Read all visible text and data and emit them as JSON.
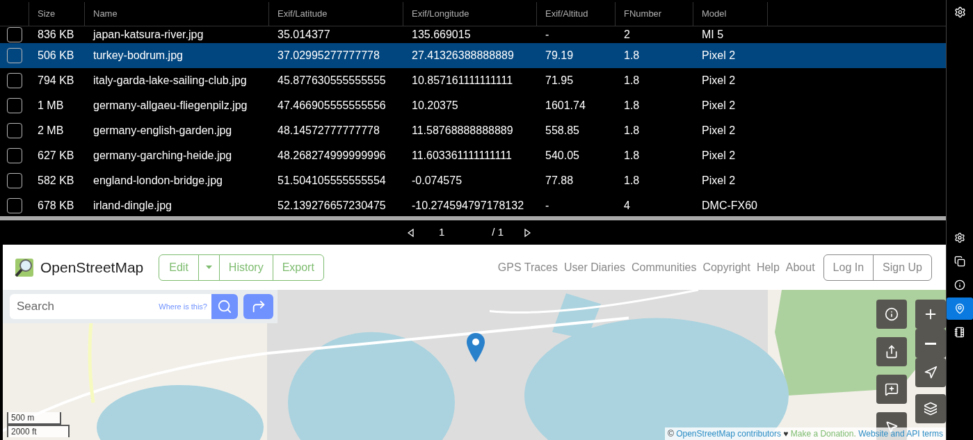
{
  "table": {
    "columns": [
      "Size",
      "Name",
      "Exif/Latitude",
      "Exif/Longitude",
      "Exif/Altitud",
      "FNumber",
      "Model"
    ],
    "rows": [
      {
        "checked": false,
        "selected": false,
        "cells": [
          "836 KB",
          "japan-katsura-river.jpg",
          "35.014377",
          "135.669015",
          "-",
          "2",
          "MI 5"
        ]
      },
      {
        "checked": false,
        "selected": true,
        "cells": [
          "506 KB",
          "turkey-bodrum.jpg",
          "37.02995277777778",
          "27.41326388888889",
          "79.19",
          "1.8",
          "Pixel 2"
        ]
      },
      {
        "checked": false,
        "selected": false,
        "cells": [
          "794 KB",
          "italy-garda-lake-sailing-club.jpg",
          "45.877630555555555",
          "10.857161111111111",
          "71.95",
          "1.8",
          "Pixel 2"
        ]
      },
      {
        "checked": false,
        "selected": false,
        "cells": [
          "1 MB",
          "germany-allgaeu-fliegenpilz.jpg",
          "47.466905555555556",
          "10.20375",
          "1601.74",
          "1.8",
          "Pixel 2"
        ]
      },
      {
        "checked": false,
        "selected": false,
        "cells": [
          "2 MB",
          "germany-english-garden.jpg",
          "48.14572777777778",
          "11.58768888888889",
          "558.85",
          "1.8",
          "Pixel 2"
        ]
      },
      {
        "checked": false,
        "selected": false,
        "cells": [
          "627 KB",
          "germany-garching-heide.jpg",
          "48.268274999999996",
          "11.603361111111111",
          "540.05",
          "1.8",
          "Pixel 2"
        ]
      },
      {
        "checked": false,
        "selected": false,
        "cells": [
          "582 KB",
          "england-london-bridge.jpg",
          "51.504105555555554",
          "-0.074575",
          "77.88",
          "1.8",
          "Pixel 2"
        ]
      },
      {
        "checked": false,
        "selected": false,
        "cells": [
          "678 KB",
          "irland-dingle.jpg",
          "52.139276657230475",
          "-10.274594797178132",
          "-",
          "4",
          "DMC-FX60"
        ]
      }
    ]
  },
  "pager": {
    "page": "1",
    "total": "/ 1"
  },
  "sidebar": {
    "items": [
      {
        "kind": "settings",
        "selected": false
      },
      {
        "kind": "copy",
        "selected": false
      },
      {
        "kind": "info",
        "selected": false
      },
      {
        "kind": "pin",
        "selected": true
      },
      {
        "kind": "book",
        "selected": false
      }
    ]
  },
  "osm": {
    "brand": "OpenStreetMap",
    "edit_buttons": [
      "Edit",
      "History",
      "Export"
    ],
    "nav": [
      "GPS Traces",
      "User Diaries",
      "Communities",
      "Copyright",
      "Help",
      "About"
    ],
    "auth": [
      "Log In",
      "Sign Up"
    ],
    "search": {
      "placeholder": "Search",
      "hint": "Where is this?"
    },
    "scale": [
      "500 m",
      "2000 ft"
    ],
    "attribution": [
      {
        "kind": "plain",
        "text": "©"
      },
      {
        "kind": "link",
        "text": "OpenStreetMap contributors"
      },
      {
        "kind": "plain",
        "text": "♥"
      },
      {
        "kind": "donate",
        "text": "Make a Donation."
      },
      {
        "kind": "link",
        "text": "Website and API terms"
      }
    ]
  }
}
